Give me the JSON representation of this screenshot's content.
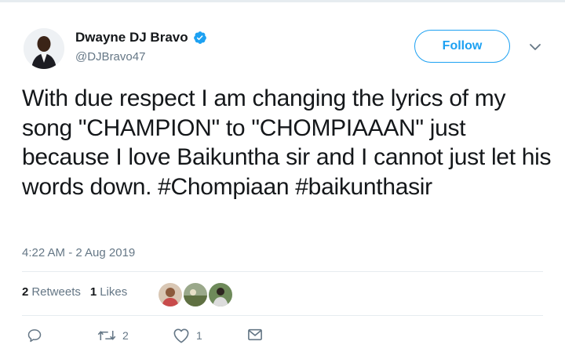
{
  "author": {
    "name": "Dwayne DJ Bravo",
    "handle": "@DJBravo47",
    "verified_color": "#1da1f2"
  },
  "follow_button": {
    "label": "Follow"
  },
  "menu_icon": "chevron-down-icon",
  "tweet": {
    "text": "With due respect I am changing the lyrics of my song \"CHAMPION\" to \"CHOMPIAAAN\" just because I love Baikuntha sir and I cannot just let his words down. #Chompiaan #baikunthasir",
    "timestamp": "4:22 AM - 2 Aug 2019"
  },
  "stats": {
    "retweets_count": "2",
    "retweets_label": "Retweets",
    "likes_count": "1",
    "likes_label": "Likes"
  },
  "actions": {
    "reply_icon": "reply-icon",
    "retweet_icon": "retweet-icon",
    "retweet_count": "2",
    "like_icon": "heart-icon",
    "like_count": "1",
    "dm_icon": "envelope-icon"
  },
  "colors": {
    "accent": "#1da1f2",
    "secondary_text": "#657786",
    "primary_text": "#14171a",
    "divider": "#e6ecf0"
  }
}
